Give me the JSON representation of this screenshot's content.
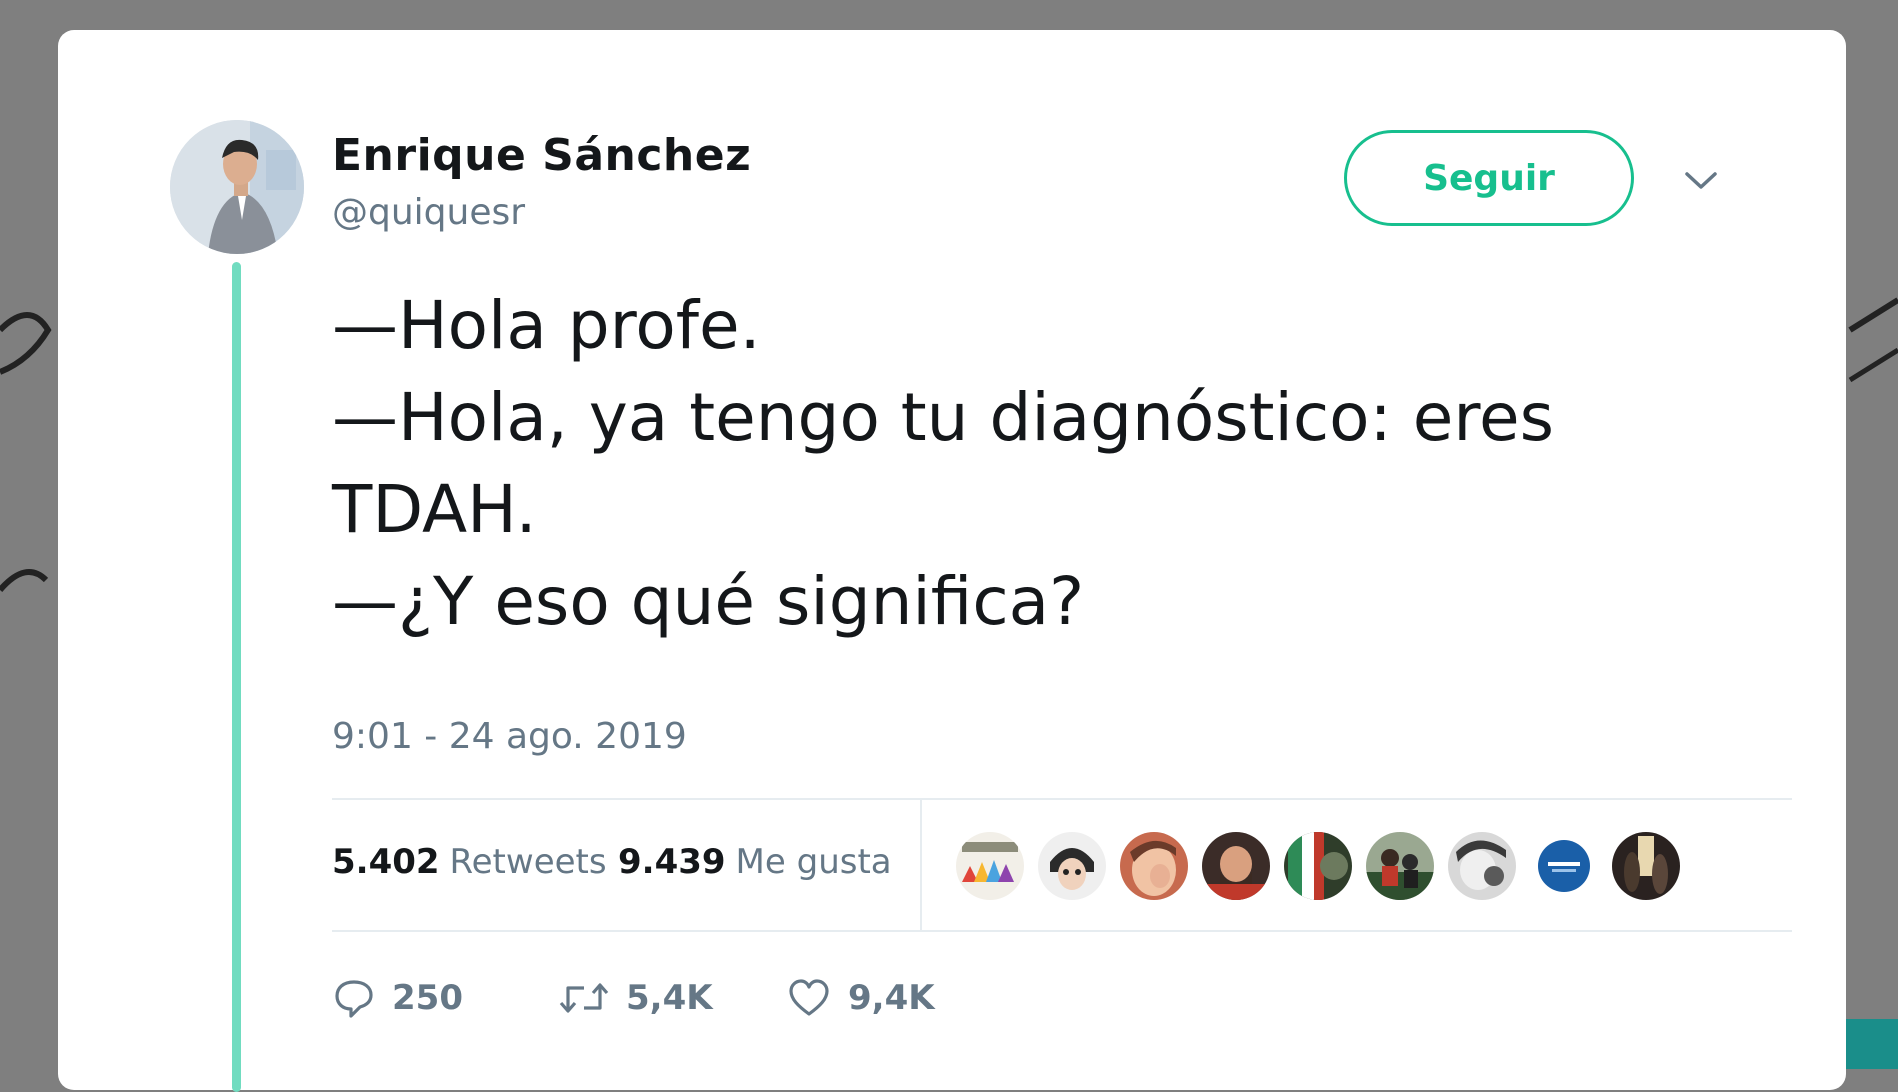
{
  "tweet": {
    "author": {
      "display_name": "Enrique Sánchez",
      "handle": "@quiquesr"
    },
    "follow_label": "Seguir",
    "lines": [
      "—Hola profe.",
      "—Hola, ya tengo tu diagnóstico: eres",
      "TDAH.",
      "—¿Y eso qué significa?"
    ],
    "timestamp": "9:01 - 24 ago. 2019",
    "stats": {
      "retweets_count": "5.402",
      "retweets_label": "Retweets",
      "likes_count": "9.439",
      "likes_label": "Me gusta"
    },
    "liker_avatar_count": 9,
    "actions": {
      "reply_count": "250",
      "retweet_count": "5,4K",
      "like_count": "9,4K"
    }
  },
  "colors": {
    "accent": "#17bf8e",
    "thread_line": "#71dcc0",
    "secondary_text": "#657786",
    "primary_text": "#14171a",
    "overlay": "#7f7f7f"
  },
  "icons": {
    "reply": "speech-bubble-icon",
    "retweet": "retweet-arrows-icon",
    "like": "heart-outline-icon",
    "more": "chevron-down-icon"
  }
}
